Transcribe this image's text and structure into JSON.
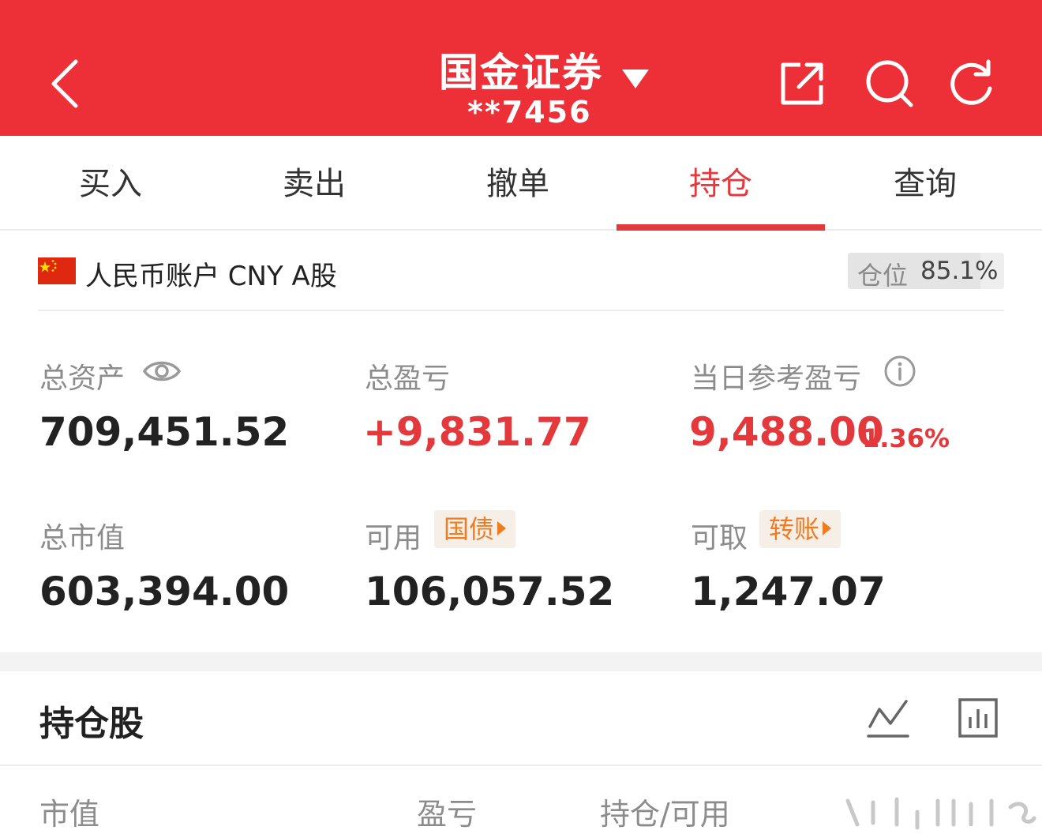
{
  "header": {
    "broker": "国金证券",
    "account": "**7456",
    "icons": [
      "back-arrow-icon",
      "dropdown-triangle-icon",
      "share-out-icon",
      "search-icon",
      "refresh-icon"
    ]
  },
  "tabs": [
    {
      "label": "买入",
      "active": false
    },
    {
      "label": "卖出",
      "active": false
    },
    {
      "label": "撤单",
      "active": false
    },
    {
      "label": "持仓",
      "active": true
    },
    {
      "label": "查询",
      "active": false
    }
  ],
  "account_row": {
    "label": "人民币账户 CNY A股",
    "position_label": "仓位",
    "position_value": "85.1%",
    "position_fraction": 0.851
  },
  "metrics": {
    "total_assets": {
      "label": "总资产",
      "value": "709,451.52"
    },
    "total_pnl": {
      "label": "总盈亏",
      "value": "+9,831.77"
    },
    "daily_pnl": {
      "label": "当日参考盈亏",
      "value": "9,488.00",
      "percent": "1.36%"
    },
    "market_value": {
      "label": "总市值",
      "value": "603,394.00"
    },
    "available": {
      "label": "可用",
      "value": "106,057.52",
      "link": "国债"
    },
    "withdrawable": {
      "label": "可取",
      "value": "1,247.07",
      "link": "转账"
    }
  },
  "holdings": {
    "title": "持仓股",
    "columns": [
      "市值",
      "盈亏",
      "持仓/可用"
    ]
  },
  "colors": {
    "header_bg": "#ed3038",
    "accent_red": "#e4393c",
    "link_orange": "#f07b20"
  }
}
